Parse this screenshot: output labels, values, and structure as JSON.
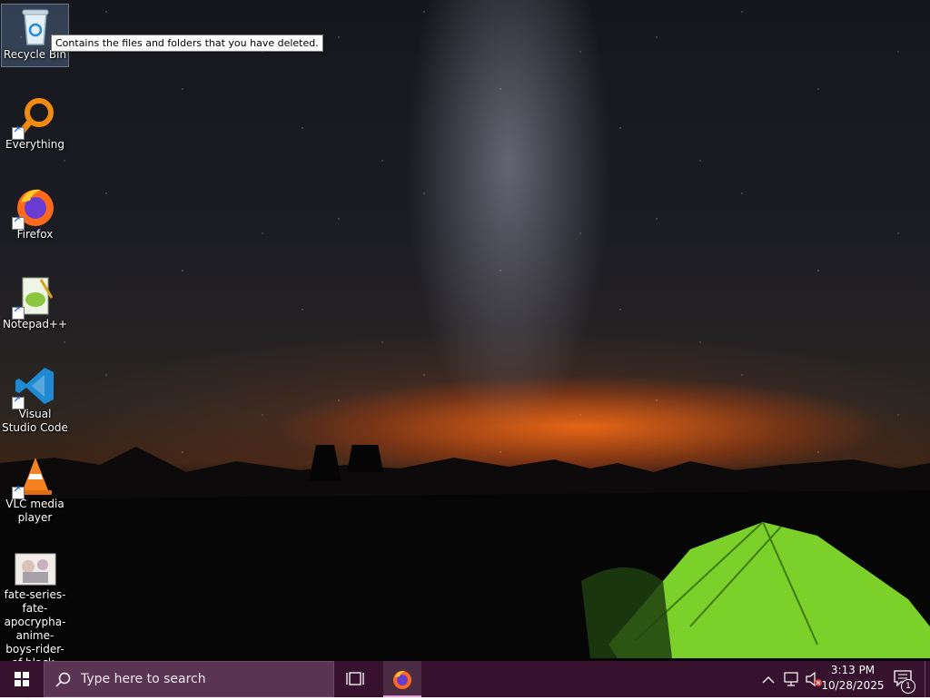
{
  "desktop": {
    "icons": [
      {
        "label": "Recycle Bin",
        "icon": "recycle-bin-icon"
      },
      {
        "label": "Everything",
        "icon": "everything-search-icon"
      },
      {
        "label": "Firefox",
        "icon": "firefox-icon"
      },
      {
        "label": "Notepad++",
        "icon": "notepadpp-icon"
      },
      {
        "label": "Visual Studio Code",
        "icon": "vscode-icon"
      },
      {
        "label": "VLC media player",
        "icon": "vlc-icon"
      },
      {
        "label": "fate-series-fate-apocrypha-anime-boys-rider-of-black-wallpaper-pre",
        "icon": "image-thumbnail-icon"
      }
    ],
    "tooltip": "Contains the files and folders that you have deleted."
  },
  "taskbar": {
    "search_placeholder": "Type here to search",
    "time": "3:13 PM",
    "date": "10/28/2025",
    "notification_count": "1",
    "accent": "#37122e"
  }
}
